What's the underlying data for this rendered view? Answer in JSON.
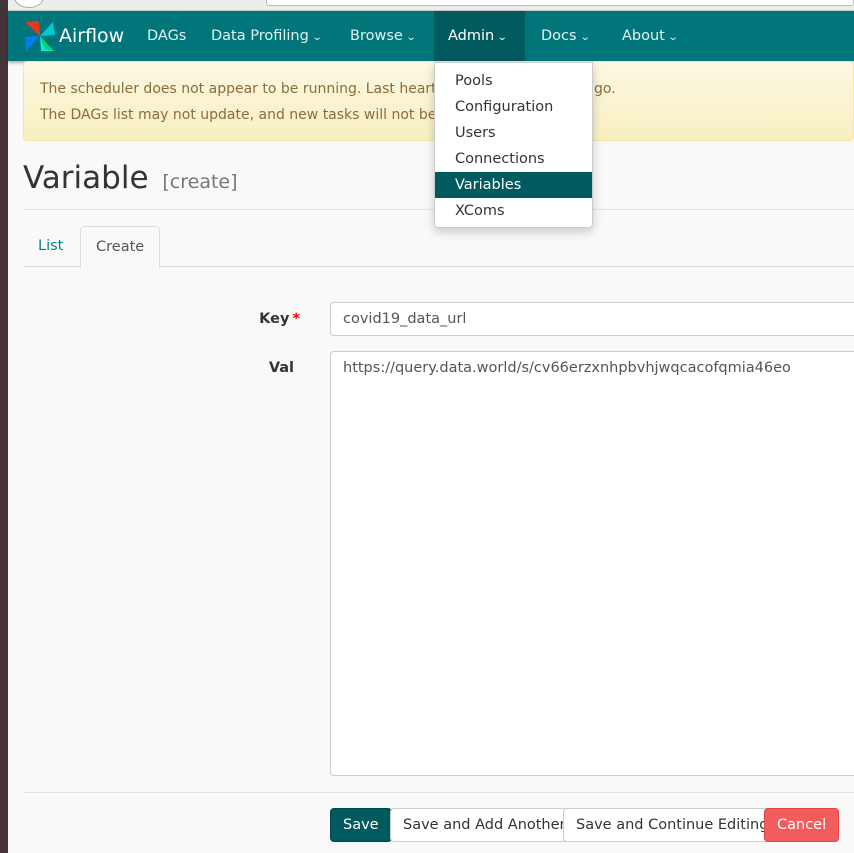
{
  "nav": {
    "brand": "Airflow",
    "items": [
      {
        "label": "DAGs"
      },
      {
        "label": "Data Profiling"
      },
      {
        "label": "Browse"
      },
      {
        "label": "Admin"
      },
      {
        "label": "Docs"
      },
      {
        "label": "About"
      }
    ]
  },
  "alert": {
    "line1_start": "The scheduler does not appear to be running. Last heartbeat",
    "line1_end": "go.",
    "line2": "The DAGs list may not update, and new tasks will not be sche"
  },
  "admin_menu": {
    "items": [
      "Pools",
      "Configuration",
      "Users",
      "Connections",
      "Variables",
      "XComs"
    ],
    "active": "Variables"
  },
  "page": {
    "title": "Variable",
    "subtitle": "[create]"
  },
  "tabs": {
    "list": "List",
    "create": "Create"
  },
  "form": {
    "key_label": "Key",
    "required_mark": "*",
    "key_value": "covid19_data_url",
    "val_label": "Val",
    "val_value": "https://query.data.world/s/cv66erzxnhpbvhjwqcacofqmia46eo"
  },
  "buttons": {
    "save": "Save",
    "save_add": "Save and Add Another",
    "save_continue": "Save and Continue Editing",
    "cancel": "Cancel"
  },
  "colors": {
    "navbar": "#00767a",
    "active": "#005a5e",
    "danger": "#f25c5c",
    "alert_bg": "#fcf8e3"
  }
}
